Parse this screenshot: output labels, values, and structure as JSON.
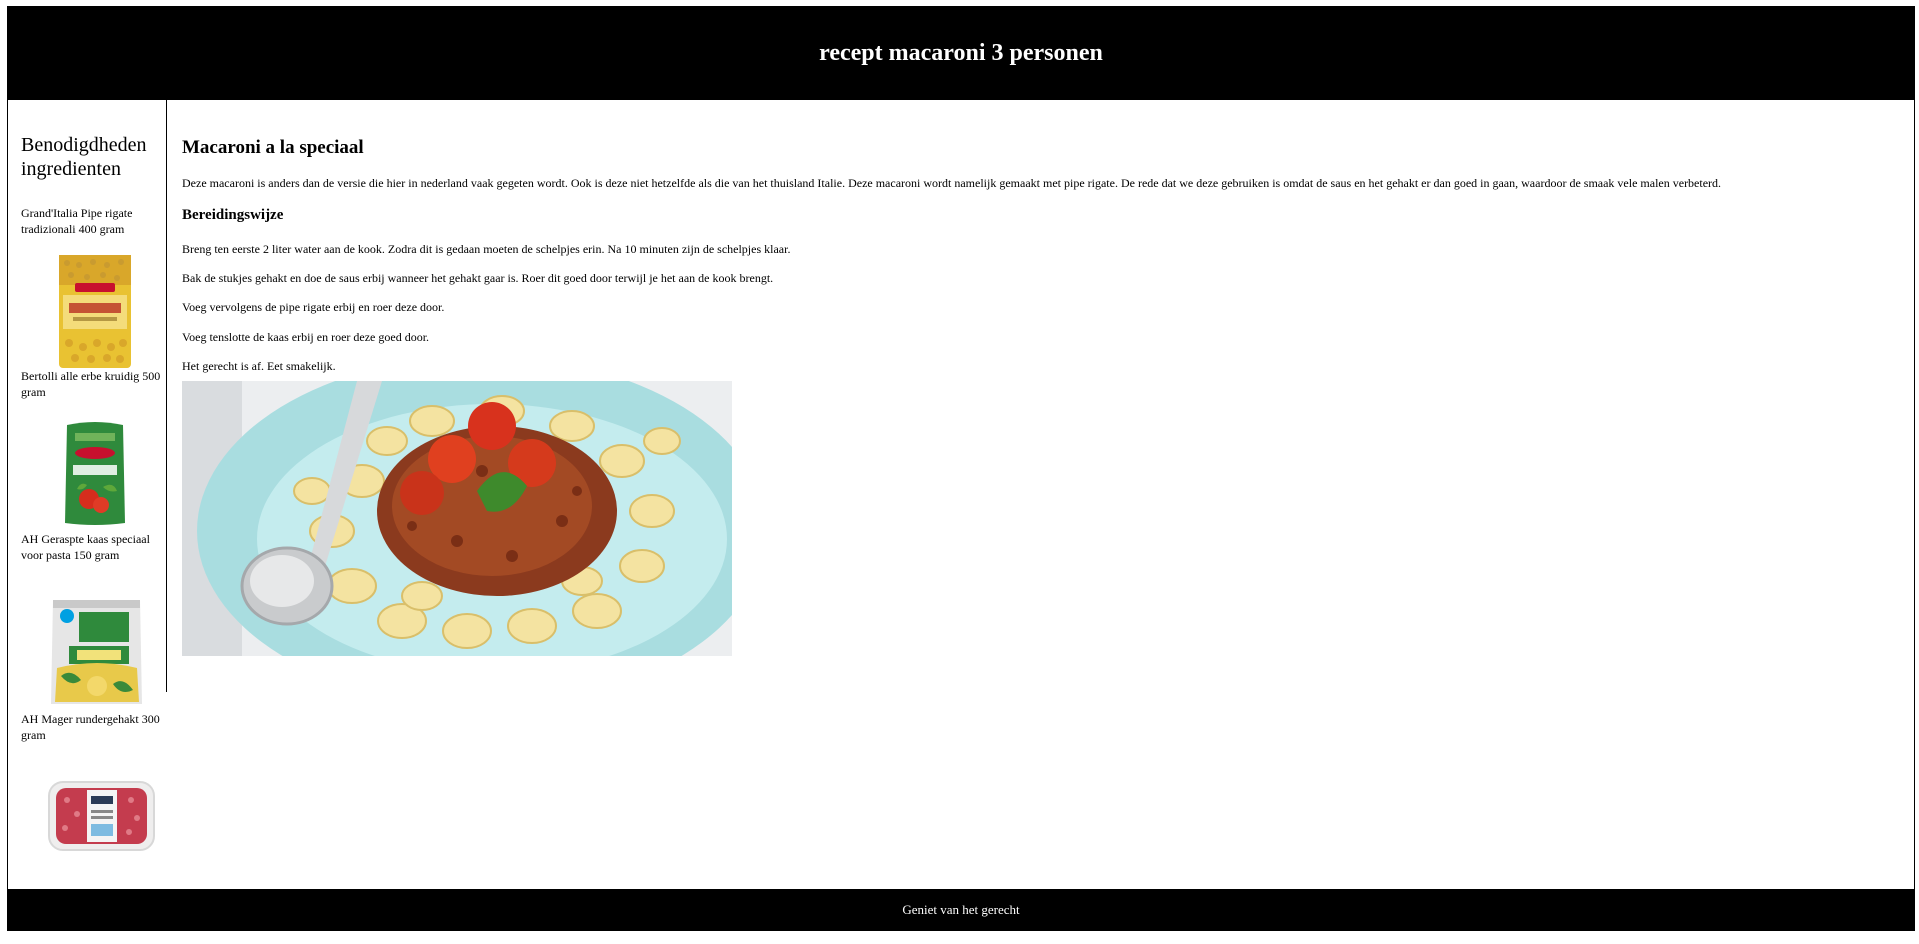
{
  "header": {
    "title": "recept macaroni 3 personen"
  },
  "sidebar": {
    "title": "Benodigdheden ingredienten",
    "items": [
      {
        "label": "Grand'Italia Pipe rigate tradizionali 400 gram",
        "image": "pipe-rigate-package"
      },
      {
        "label": "Bertolli alle erbe kruidig 500 gram",
        "image": "bertolli-sauce-pouch"
      },
      {
        "label": "AH Geraspte kaas speciaal voor pasta 150 gram",
        "image": "grated-cheese-bag"
      },
      {
        "label": "AH Mager rundergehakt 300 gram",
        "image": "minced-beef-tray"
      }
    ]
  },
  "main": {
    "title": "Macaroni a la speciaal",
    "intro": "Deze macaroni is anders dan de versie die hier in nederland vaak gegeten wordt. Ook is deze niet hetzelfde als die van het thuisland Italie. Deze macaroni wordt namelijk gemaakt met pipe rigate. De rede dat we deze gebruiken is omdat de saus en het gehakt er dan goed in gaan, waardoor de smaak vele malen verbeterd.",
    "method_title": "Bereidingswijze",
    "steps": [
      "Breng ten eerste 2 liter water aan de kook. Zodra dit is gedaan moeten de schelpjes erin. Na 10 minuten zijn de schelpjes klaar.",
      "Bak de stukjes gehakt en doe de saus erbij wanneer het gehakt gaar is. Roer dit goed door terwijl je het aan de kook brengt.",
      "Voeg vervolgens de pipe rigate erbij en roer deze door.",
      "Voeg tenslotte de kaas erbij en roer deze goed door.",
      "Het gerecht is af. Eet smakelijk."
    ],
    "dish_image": "pasta-bolognese-plate"
  },
  "footer": {
    "text": "Geniet van het gerecht"
  }
}
